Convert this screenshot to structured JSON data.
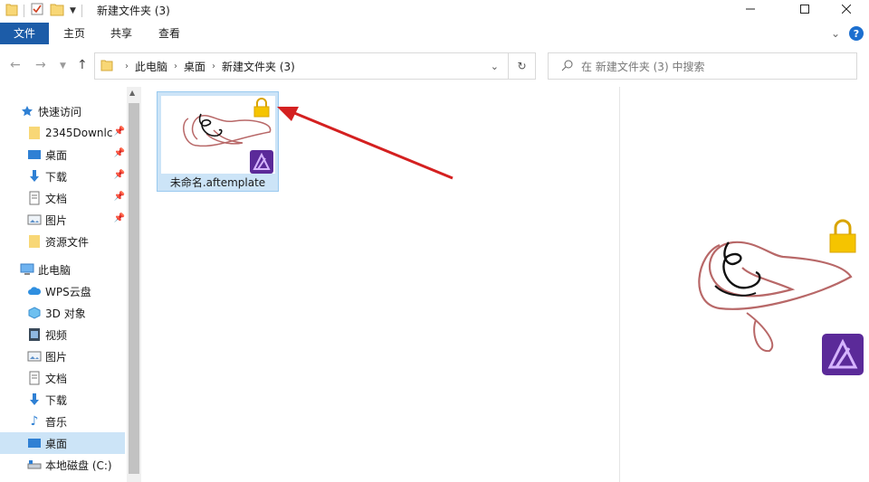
{
  "window": {
    "title": "新建文件夹 (3)"
  },
  "ribbon": {
    "tabs": [
      "文件",
      "主页",
      "共享",
      "查看"
    ]
  },
  "address": {
    "crumbs": [
      "此电脑",
      "桌面",
      "新建文件夹 (3)"
    ]
  },
  "search": {
    "placeholder": "在 新建文件夹 (3) 中搜索"
  },
  "nav": {
    "quick_access": "快速访问",
    "quick_items": [
      "2345Downlc",
      "桌面",
      "下载",
      "文档",
      "图片",
      "资源文件"
    ],
    "this_pc": "此电脑",
    "pc_items": [
      "WPS云盘",
      "3D 对象",
      "视频",
      "图片",
      "文档",
      "下载",
      "音乐",
      "桌面",
      "本地磁盘 (C:)"
    ]
  },
  "files": [
    {
      "name": "未命名.aftemplate",
      "selected": true,
      "locked": true
    }
  ],
  "colors": {
    "accent": "#1c5ca8",
    "selection": "#cce4f7",
    "arrow": "#d42020",
    "affinity": "#7b3fc4"
  },
  "icons": [
    "folder-icon",
    "checkbox-icon",
    "minimize-icon",
    "maximize-icon",
    "close-icon",
    "back-icon",
    "forward-icon",
    "up-icon",
    "refresh-icon",
    "search-icon",
    "star-icon",
    "pin-icon",
    "lock-icon",
    "affinity-icon",
    "help-icon"
  ]
}
